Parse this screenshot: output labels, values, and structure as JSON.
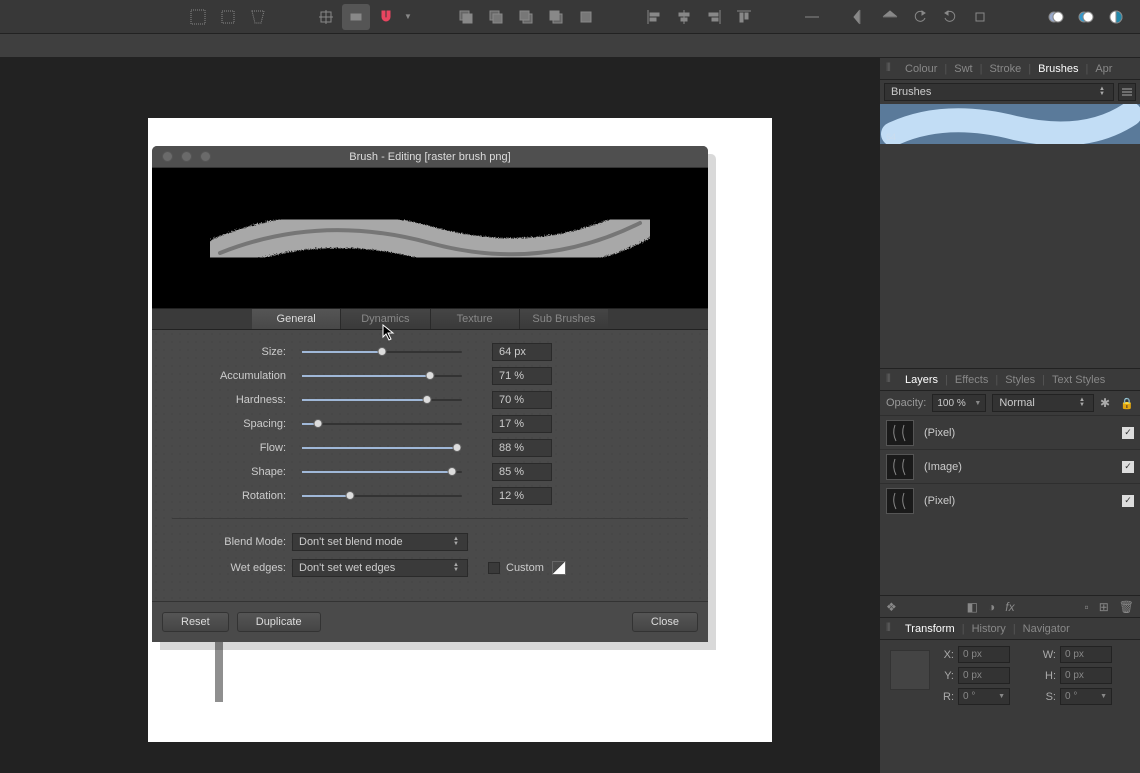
{
  "toolbar_icons": [
    "grid-select",
    "rect-select",
    "lasso",
    "pixel-grid",
    "snap-box",
    "magnet",
    "caret",
    "group1a",
    "group1b",
    "group1c",
    "group1d",
    "group1e",
    "align1",
    "align2",
    "align3",
    "align4",
    "align5",
    "flip-h",
    "flip-v",
    "rotate1",
    "rotate2",
    "rotate3",
    "circle1",
    "circle2",
    "circle3"
  ],
  "dialog": {
    "title": "Brush - Editing [raster brush png]",
    "tabs": [
      "General",
      "Dynamics",
      "Texture",
      "Sub Brushes"
    ],
    "active_tab": "General",
    "sliders": [
      {
        "label": "Size:",
        "value": "64 px",
        "pct": 50
      },
      {
        "label": "Accumulation",
        "value": "71 %",
        "pct": 80
      },
      {
        "label": "Hardness:",
        "value": "70 %",
        "pct": 78
      },
      {
        "label": "Spacing:",
        "value": "17 %",
        "pct": 10
      },
      {
        "label": "Flow:",
        "value": "88 %",
        "pct": 97
      },
      {
        "label": "Shape:",
        "value": "85 %",
        "pct": 94
      },
      {
        "label": "Rotation:",
        "value": "12 %",
        "pct": 30
      }
    ],
    "blend_mode": {
      "label": "Blend Mode:",
      "value": "Don't set blend mode"
    },
    "wet_edges": {
      "label": "Wet edges:",
      "value": "Don't set wet edges"
    },
    "custom": "Custom",
    "buttons": {
      "reset": "Reset",
      "duplicate": "Duplicate",
      "close": "Close"
    }
  },
  "right": {
    "studio_tabs": [
      "Colour",
      "Swt",
      "Stroke",
      "Brushes",
      "Apr"
    ],
    "active_studio": "Brushes",
    "brush_category": "Brushes",
    "brush_thumb_size": "64",
    "layers_tabs": [
      "Layers",
      "Effects",
      "Styles",
      "Text Styles"
    ],
    "active_layers_tab": "Layers",
    "opacity_label": "Opacity:",
    "opacity_value": "100 %",
    "blend_value": "Normal",
    "layers": [
      {
        "name": "(Pixel)"
      },
      {
        "name": "(Image)"
      },
      {
        "name": "(Pixel)"
      }
    ],
    "transform_tabs": [
      "Transform",
      "History",
      "Navigator"
    ],
    "active_transform_tab": "Transform",
    "transform": {
      "x": "0 px",
      "y": "0 px",
      "w": "0 px",
      "h": "0 px",
      "r": "0 °",
      "s": "0 °"
    }
  }
}
